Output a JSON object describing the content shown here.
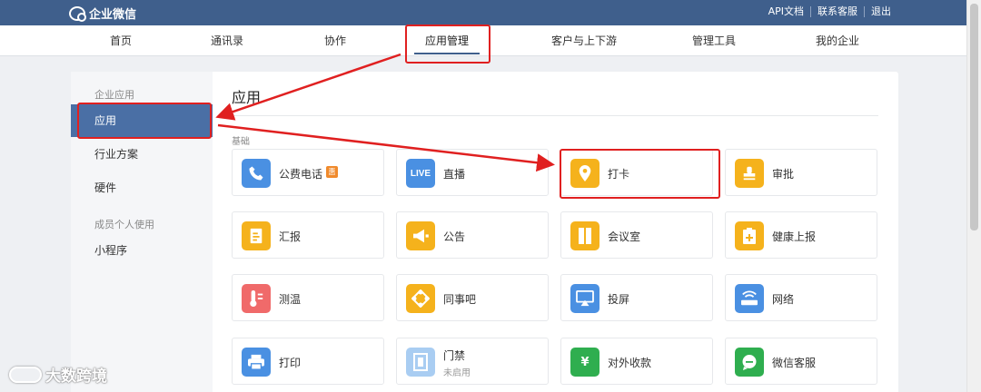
{
  "topbar": {
    "logo_text": "企业微信",
    "links": [
      "API文档",
      "联系客服",
      "退出"
    ]
  },
  "nav": {
    "items": [
      "首页",
      "通讯录",
      "协作",
      "应用管理",
      "客户与上下游",
      "管理工具",
      "我的企业"
    ],
    "active": "应用管理"
  },
  "sidebar": {
    "group1": "企业应用",
    "items1": [
      "应用",
      "行业方案",
      "硬件"
    ],
    "active": "应用",
    "group2": "成员个人使用",
    "items2": [
      "小程序"
    ]
  },
  "main": {
    "title": "应用",
    "section": "基础",
    "apps": [
      {
        "name": "公费电话",
        "icon": "phone-icon",
        "color": "#4a90e2",
        "badge": "惠"
      },
      {
        "name": "直播",
        "icon": "live-icon",
        "color": "#4a90e2",
        "icon_text": "LIVE"
      },
      {
        "name": "打卡",
        "icon": "location-pin-icon",
        "color": "#f5b21c"
      },
      {
        "name": "审批",
        "icon": "stamp-icon",
        "color": "#f5b21c"
      },
      {
        "name": "汇报",
        "icon": "report-icon",
        "color": "#f5b21c"
      },
      {
        "name": "公告",
        "icon": "megaphone-icon",
        "color": "#f5b21c"
      },
      {
        "name": "会议室",
        "icon": "door-icon",
        "color": "#f5b21c"
      },
      {
        "name": "健康上报",
        "icon": "health-clipboard-icon",
        "color": "#f5b21c"
      },
      {
        "name": "测温",
        "icon": "thermometer-icon",
        "color": "#f06a6a"
      },
      {
        "name": "同事吧",
        "icon": "network-icon",
        "color": "#f5b21c"
      },
      {
        "name": "投屏",
        "icon": "screen-cast-icon",
        "color": "#4a90e2"
      },
      {
        "name": "网络",
        "icon": "wifi-router-icon",
        "color": "#4a90e2"
      },
      {
        "name": "打印",
        "icon": "printer-icon",
        "color": "#4a90e2"
      },
      {
        "name": "门禁",
        "icon": "access-door-icon",
        "color": "#a9cdf2",
        "sub": "未启用"
      },
      {
        "name": "对外收款",
        "icon": "payment-icon",
        "color": "#2fae4f",
        "icon_text": "¥"
      },
      {
        "name": "微信客服",
        "icon": "chat-bubble-icon",
        "color": "#2fae4f"
      }
    ]
  },
  "watermark": "大数跨境",
  "colors": {
    "topbar": "#3f5f8c",
    "highlight": "#e02020",
    "sidebar_active": "#4a6fa5"
  }
}
